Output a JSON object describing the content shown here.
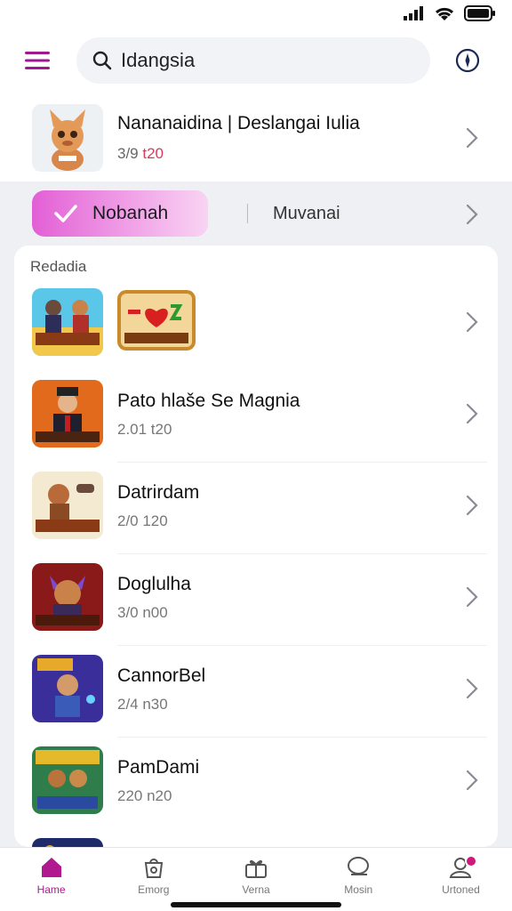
{
  "header": {
    "search_query": "Idangsia"
  },
  "featured": {
    "title": "Nananaidina | Deslangai Iulia",
    "meta_prefix": "3/9 ",
    "meta_highlight": "t20"
  },
  "tabs": {
    "active_label": "Nobanah",
    "other_label": "Muvanai"
  },
  "section": {
    "label": "Redadia"
  },
  "rows": [
    {
      "title": "",
      "meta": ""
    },
    {
      "title": "Pato hlaše Se Magnia",
      "meta": "2.01 t20"
    },
    {
      "title": "Datrirdam",
      "meta": "2/0 120"
    },
    {
      "title": "Doglulha",
      "meta": "3/0 n00"
    },
    {
      "title": "CannorBel",
      "meta": "2/4 n30"
    },
    {
      "title": "PamDami",
      "meta": "220 n20"
    }
  ],
  "bottom_nav": [
    {
      "label": "Hame",
      "icon": "home-icon",
      "active": true
    },
    {
      "label": "Emorg",
      "icon": "bag-icon",
      "active": false
    },
    {
      "label": "Verna",
      "icon": "gift-icon",
      "active": false
    },
    {
      "label": "Mosin",
      "icon": "chat-icon",
      "active": false
    },
    {
      "label": "Urtoned",
      "icon": "profile-icon",
      "active": false
    }
  ],
  "colors": {
    "accent": "#b0198f",
    "tab_gradient_start": "#e25fd5",
    "highlight_red": "#d83a5c"
  }
}
